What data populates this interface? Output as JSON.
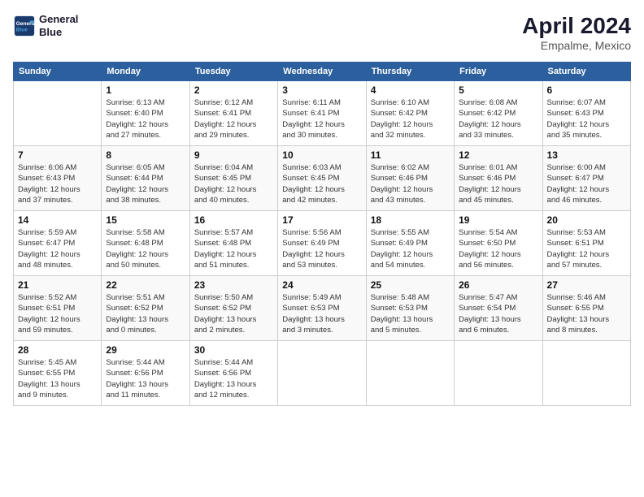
{
  "header": {
    "logo_line1": "General",
    "logo_line2": "Blue",
    "month": "April 2024",
    "location": "Empalme, Mexico"
  },
  "days_of_week": [
    "Sunday",
    "Monday",
    "Tuesday",
    "Wednesday",
    "Thursday",
    "Friday",
    "Saturday"
  ],
  "weeks": [
    [
      {
        "day": "",
        "info": ""
      },
      {
        "day": "1",
        "info": "Sunrise: 6:13 AM\nSunset: 6:40 PM\nDaylight: 12 hours\nand 27 minutes."
      },
      {
        "day": "2",
        "info": "Sunrise: 6:12 AM\nSunset: 6:41 PM\nDaylight: 12 hours\nand 29 minutes."
      },
      {
        "day": "3",
        "info": "Sunrise: 6:11 AM\nSunset: 6:41 PM\nDaylight: 12 hours\nand 30 minutes."
      },
      {
        "day": "4",
        "info": "Sunrise: 6:10 AM\nSunset: 6:42 PM\nDaylight: 12 hours\nand 32 minutes."
      },
      {
        "day": "5",
        "info": "Sunrise: 6:08 AM\nSunset: 6:42 PM\nDaylight: 12 hours\nand 33 minutes."
      },
      {
        "day": "6",
        "info": "Sunrise: 6:07 AM\nSunset: 6:43 PM\nDaylight: 12 hours\nand 35 minutes."
      }
    ],
    [
      {
        "day": "7",
        "info": "Sunrise: 6:06 AM\nSunset: 6:43 PM\nDaylight: 12 hours\nand 37 minutes."
      },
      {
        "day": "8",
        "info": "Sunrise: 6:05 AM\nSunset: 6:44 PM\nDaylight: 12 hours\nand 38 minutes."
      },
      {
        "day": "9",
        "info": "Sunrise: 6:04 AM\nSunset: 6:45 PM\nDaylight: 12 hours\nand 40 minutes."
      },
      {
        "day": "10",
        "info": "Sunrise: 6:03 AM\nSunset: 6:45 PM\nDaylight: 12 hours\nand 42 minutes."
      },
      {
        "day": "11",
        "info": "Sunrise: 6:02 AM\nSunset: 6:46 PM\nDaylight: 12 hours\nand 43 minutes."
      },
      {
        "day": "12",
        "info": "Sunrise: 6:01 AM\nSunset: 6:46 PM\nDaylight: 12 hours\nand 45 minutes."
      },
      {
        "day": "13",
        "info": "Sunrise: 6:00 AM\nSunset: 6:47 PM\nDaylight: 12 hours\nand 46 minutes."
      }
    ],
    [
      {
        "day": "14",
        "info": "Sunrise: 5:59 AM\nSunset: 6:47 PM\nDaylight: 12 hours\nand 48 minutes."
      },
      {
        "day": "15",
        "info": "Sunrise: 5:58 AM\nSunset: 6:48 PM\nDaylight: 12 hours\nand 50 minutes."
      },
      {
        "day": "16",
        "info": "Sunrise: 5:57 AM\nSunset: 6:48 PM\nDaylight: 12 hours\nand 51 minutes."
      },
      {
        "day": "17",
        "info": "Sunrise: 5:56 AM\nSunset: 6:49 PM\nDaylight: 12 hours\nand 53 minutes."
      },
      {
        "day": "18",
        "info": "Sunrise: 5:55 AM\nSunset: 6:49 PM\nDaylight: 12 hours\nand 54 minutes."
      },
      {
        "day": "19",
        "info": "Sunrise: 5:54 AM\nSunset: 6:50 PM\nDaylight: 12 hours\nand 56 minutes."
      },
      {
        "day": "20",
        "info": "Sunrise: 5:53 AM\nSunset: 6:51 PM\nDaylight: 12 hours\nand 57 minutes."
      }
    ],
    [
      {
        "day": "21",
        "info": "Sunrise: 5:52 AM\nSunset: 6:51 PM\nDaylight: 12 hours\nand 59 minutes."
      },
      {
        "day": "22",
        "info": "Sunrise: 5:51 AM\nSunset: 6:52 PM\nDaylight: 13 hours\nand 0 minutes."
      },
      {
        "day": "23",
        "info": "Sunrise: 5:50 AM\nSunset: 6:52 PM\nDaylight: 13 hours\nand 2 minutes."
      },
      {
        "day": "24",
        "info": "Sunrise: 5:49 AM\nSunset: 6:53 PM\nDaylight: 13 hours\nand 3 minutes."
      },
      {
        "day": "25",
        "info": "Sunrise: 5:48 AM\nSunset: 6:53 PM\nDaylight: 13 hours\nand 5 minutes."
      },
      {
        "day": "26",
        "info": "Sunrise: 5:47 AM\nSunset: 6:54 PM\nDaylight: 13 hours\nand 6 minutes."
      },
      {
        "day": "27",
        "info": "Sunrise: 5:46 AM\nSunset: 6:55 PM\nDaylight: 13 hours\nand 8 minutes."
      }
    ],
    [
      {
        "day": "28",
        "info": "Sunrise: 5:45 AM\nSunset: 6:55 PM\nDaylight: 13 hours\nand 9 minutes."
      },
      {
        "day": "29",
        "info": "Sunrise: 5:44 AM\nSunset: 6:56 PM\nDaylight: 13 hours\nand 11 minutes."
      },
      {
        "day": "30",
        "info": "Sunrise: 5:44 AM\nSunset: 6:56 PM\nDaylight: 13 hours\nand 12 minutes."
      },
      {
        "day": "",
        "info": ""
      },
      {
        "day": "",
        "info": ""
      },
      {
        "day": "",
        "info": ""
      },
      {
        "day": "",
        "info": ""
      }
    ]
  ]
}
